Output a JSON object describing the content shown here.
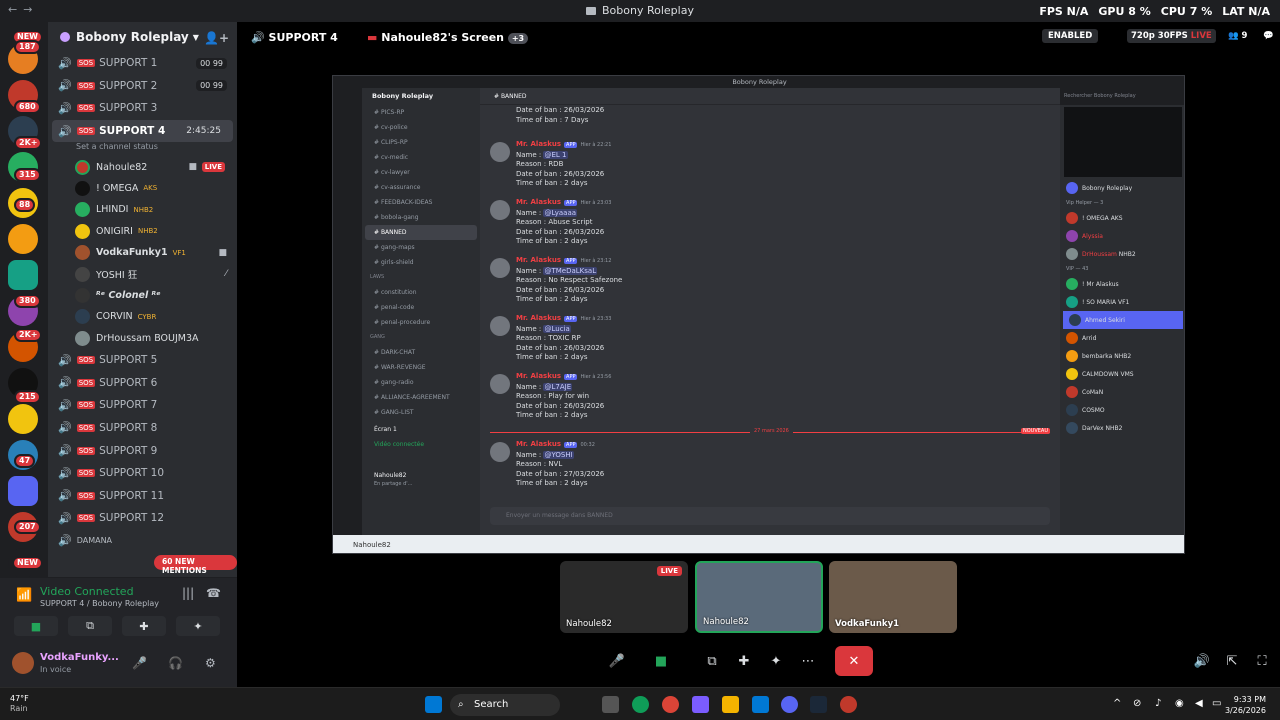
{
  "window": {
    "title": "Bobony Roleplay"
  },
  "overlay": {
    "fps_label": "FPS",
    "fps": "N/A",
    "gpu_label": "GPU",
    "gpu": "8 %",
    "cpu_label": "CPU",
    "cpu": "7 %",
    "lat_label": "LAT",
    "lat": "N/A"
  },
  "server": {
    "name": "Bobony Roleplay"
  },
  "server_badges": [
    "NEW",
    "187",
    "680",
    "2K+",
    "315",
    "88",
    "380",
    "2K+",
    "215",
    "47",
    "207",
    "NEW"
  ],
  "channels": {
    "items": [
      {
        "label": "SUPPORT 1",
        "count": "00 99"
      },
      {
        "label": "SUPPORT 2",
        "count": "00 99"
      },
      {
        "label": "SUPPORT 3"
      },
      {
        "label": "SUPPORT 4",
        "timer": "2:45:25",
        "status": "Set a channel status"
      }
    ],
    "users": [
      {
        "name": "Nahoule82",
        "live": "LIVE"
      },
      {
        "name": "! OMEGA",
        "ext": "AKS"
      },
      {
        "name": "LHINDI",
        "ext": "NHB2"
      },
      {
        "name": "ONIGIRI",
        "ext": "NHB2"
      },
      {
        "name": "VodkaFunky1",
        "ext": "VF1"
      },
      {
        "name": "YOSHI 狂"
      },
      {
        "name": "ᴿᵉ Colonel ᴿᵉ"
      },
      {
        "name": "CORVIN",
        "ext": "CYBR"
      },
      {
        "name": "DrHoussam BOUJM3A"
      }
    ],
    "more": [
      "SUPPORT 5",
      "SUPPORT 6",
      "SUPPORT 7",
      "SUPPORT 8",
      "SUPPORT 9",
      "SUPPORT 10",
      "SUPPORT 11",
      "SUPPORT 12",
      "DAMANA"
    ],
    "mentions": "60 NEW MENTIONS"
  },
  "voice": {
    "connected": "Video Connected",
    "channel": "SUPPORT 4 / Bobony Roleplay"
  },
  "user": {
    "name": "VodkaFunky...",
    "status": "In voice"
  },
  "stage": {
    "channel": "SUPPORT 4",
    "screen": "Nahoule82's Screen",
    "extra": "+3",
    "enabled": "ENABLED",
    "quality": "720p 30FPS",
    "live": "LIVE",
    "viewers": "9"
  },
  "shared": {
    "title": "Bobony Roleplay",
    "server": "Bobony Roleplay",
    "channel_header": "BANNED",
    "channels": [
      {
        "label": "PICS-RP"
      },
      {
        "label": "cv-police"
      },
      {
        "label": "CLIPS-RP"
      },
      {
        "label": "cv-medic"
      },
      {
        "label": "cv-lawyer"
      },
      {
        "label": "cv-assurance"
      },
      {
        "label": "FEEDBACK-IDEAS"
      },
      {
        "label": "bobola-gang"
      },
      {
        "label": "BANNED"
      },
      {
        "label": "gang-maps"
      },
      {
        "label": "girls-shield"
      }
    ],
    "cat_laws": "LAWS",
    "laws": [
      "constitution",
      "penal-code",
      "penal-procedure"
    ],
    "cat_gang": "GANG",
    "gang": [
      "DARK-CHAT",
      "WAR-REVENGE",
      "gang-radio",
      "ALLIANCE-AGREEMENT",
      "GANG-LIST"
    ],
    "voice_channel": "Écran 1",
    "voice_status": "Vidéo connectée",
    "inner_user": "Nahoule82",
    "inner_user_status": "En partage d'...",
    "messages": [
      {
        "date": "Date of ban : 26/03/2026",
        "time": "Time of ban : 7 Days"
      },
      {
        "author": "Mr. Alaskus",
        "app": "APP",
        "ts": "Hier à 22:21",
        "name": "Name :",
        "mention": "@EL 1",
        "reason": "Reason : RDB",
        "date": "Date of ban : 26/03/2026",
        "time": "Time of ban : 2 days"
      },
      {
        "author": "Mr. Alaskus",
        "app": "APP",
        "ts": "Hier à 23:03",
        "name": "Name :",
        "mention": "@Lyaaaa",
        "reason": "Reason : Abuse Script",
        "date": "Date of ban : 26/03/2026",
        "time": "Time of ban : 2 days"
      },
      {
        "author": "Mr. Alaskus",
        "app": "APP",
        "ts": "Hier à 23:12",
        "name": "Name :",
        "mention": "@TMeDaLKsaL",
        "reason": "Reason : No Respect Safezone",
        "date": "Date of ban : 26/03/2026",
        "time": "Time of ban : 2 days"
      },
      {
        "author": "Mr. Alaskus",
        "app": "APP",
        "ts": "Hier à 23:33",
        "name": "Name :",
        "mention": "@Lucia",
        "reason": "Reason : TOXIC RP",
        "date": "Date of ban : 26/03/2026",
        "time": "Time of ban : 2 days"
      },
      {
        "author": "Mr. Alaskus",
        "app": "APP",
        "ts": "Hier à 23:56",
        "name": "Name :",
        "mention": "@L7AJE",
        "reason": "Reason : Play for win",
        "date": "Date of ban : 26/03/2026",
        "time": "Time of ban : 2 days"
      },
      {
        "author": "Mr. Alaskus",
        "app": "APP",
        "ts": "00:32",
        "name": "Name :",
        "mention": "@YOSHI",
        "reason": "Reason : NVL",
        "date": "Date of ban : 27/03/2026",
        "time": "Time of ban : 2 days"
      }
    ],
    "divider_date": "27 mars 2026",
    "divider_new": "NOUVEAU",
    "input_placeholder": "Envoyer un message dans BANNED",
    "search_placeholder": "Rechercher Bobony Roleplay",
    "members": [
      {
        "label": "Bobony Roleplay"
      },
      {
        "label": "Vip Helper — 3",
        "cat": true
      },
      {
        "label": "! OMEGA",
        "ext": "AKS"
      },
      {
        "label": "Alyssia"
      },
      {
        "label": "DrHoussam",
        "ext": "NHB2"
      },
      {
        "label": "VIP — 43",
        "cat": true
      },
      {
        "label": "! Mr Alaskus"
      },
      {
        "label": "! SO MARIA",
        "ext": "VF1"
      },
      {
        "label": "Ahmed Sekiri"
      },
      {
        "label": "Arrid"
      },
      {
        "label": "bembarka",
        "ext": "NHB2"
      },
      {
        "label": "CALMDOWN",
        "ext": "VMS"
      },
      {
        "label": "CoMaN"
      },
      {
        "label": "COSMO"
      },
      {
        "label": "DarVex",
        "ext": "NHB2"
      }
    ],
    "inner_taskbar_user": "Nahoule82"
  },
  "thumbs": [
    {
      "name": "Nahoule82",
      "live": "LIVE"
    },
    {
      "name": "Nahoule82"
    },
    {
      "name": "VodkaFunky1"
    }
  ],
  "taskbar": {
    "temp": "47°F",
    "weather": "Rain",
    "search": "Search",
    "time": "9:33 PM",
    "date": "3/26/2026"
  }
}
